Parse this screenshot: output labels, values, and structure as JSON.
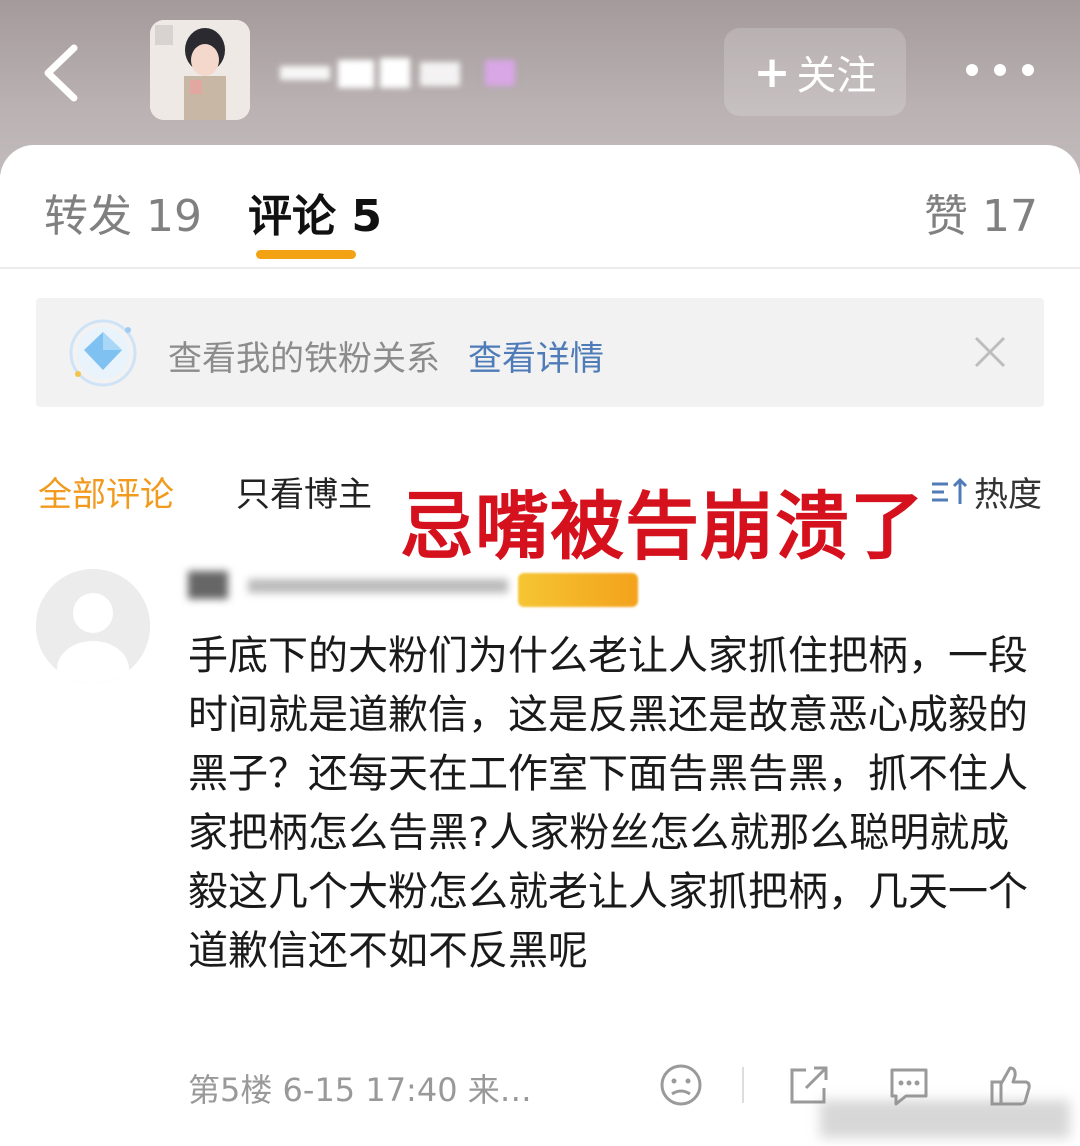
{
  "header": {
    "follow_label": "关注",
    "follow_plus": "+"
  },
  "tabs": {
    "repost": "转发 19",
    "comments": "评论 5",
    "likes": "赞 17"
  },
  "fan_banner": {
    "text": "查看我的铁粉关系",
    "link": "查看详情"
  },
  "filters": {
    "all": "全部评论",
    "author_only": "只看博主",
    "sort": "热度"
  },
  "overlay_caption": "忌嘴被告崩溃了",
  "comment": {
    "text": "手底下的大粉们为什么老让人家抓住把柄，一段时间就是道歉信，这是反黑还是故意恶心成毅的黑子？还每天在工作室下面告黑告黑，抓不住人家把柄怎么告黑?人家粉丝怎么就那么聪明就成毅这几个大粉怎么就老让人家抓把柄，几天一个道歉信还不如不反黑呢",
    "meta": "第5楼  6-15 17:40  来…"
  },
  "colors": {
    "accent_orange": "#f3a213",
    "link_blue": "#4f7cb8",
    "caption_red": "#d4111c"
  }
}
